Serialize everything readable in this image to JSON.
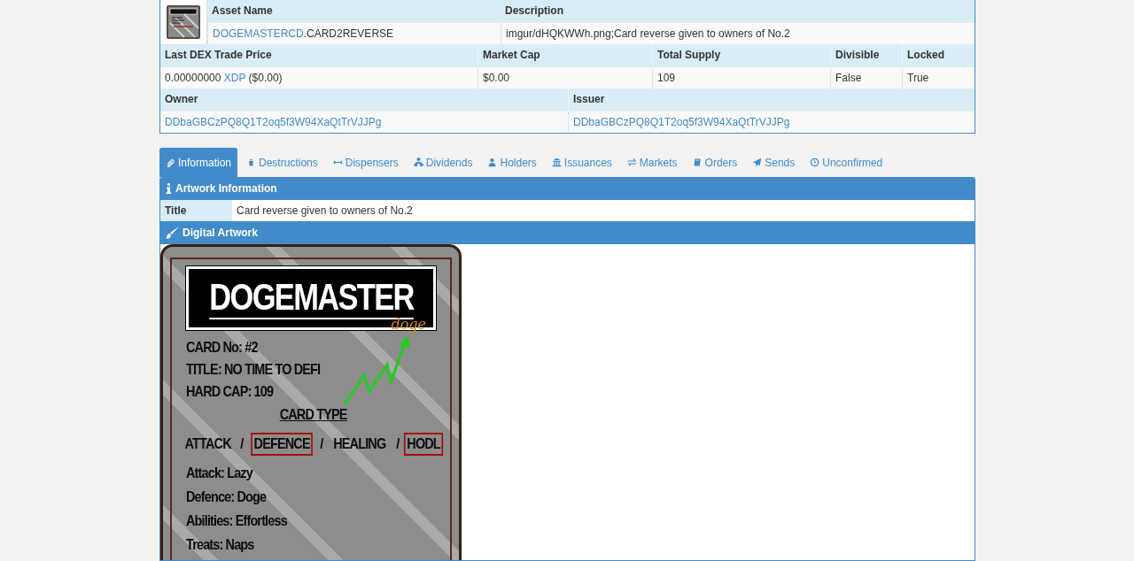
{
  "asset": {
    "name_header": "Asset Name",
    "name_link": "DOGEMASTERCD",
    "name_rest": ".CARD2REVERSE",
    "description_header": "Description",
    "description": "imgur/dHQKWWh.png;Card reverse given to owners of No.2"
  },
  "market": [
    {
      "header": "Last DEX Trade Price",
      "value": [
        {
          "kind": "plain",
          "text": "0.00000000 "
        },
        {
          "kind": "link",
          "text": "XDP"
        },
        {
          "kind": "plain",
          "text": " ($0.00)"
        }
      ]
    },
    {
      "header": "Market Cap",
      "value": [
        {
          "kind": "plain",
          "text": "$0.00"
        }
      ]
    },
    {
      "header": "Total Supply",
      "value": [
        {
          "kind": "plain",
          "text": "109"
        }
      ]
    },
    {
      "header": "Divisible",
      "value": [
        {
          "kind": "plain",
          "text": "False"
        }
      ]
    },
    {
      "header": "Locked",
      "value": [
        {
          "kind": "plain",
          "text": "True"
        }
      ]
    }
  ],
  "parties": [
    {
      "header": "Owner",
      "address": "DDbaGBCzPQ8Q1T2oq5f3W94XaQtTrVJJPg"
    },
    {
      "header": "Issuer",
      "address": "DDbaGBCzPQ8Q1T2oq5f3W94XaQtTrVJJPg"
    }
  ],
  "tabs": [
    {
      "label": "Information",
      "selected": true
    },
    {
      "label": "Destructions",
      "selected": false
    },
    {
      "label": "Dispensers",
      "selected": false
    },
    {
      "label": "Dividends",
      "selected": false
    },
    {
      "label": "Holders",
      "selected": false
    },
    {
      "label": "Issuances",
      "selected": false
    },
    {
      "label": "Markets",
      "selected": false
    },
    {
      "label": "Orders",
      "selected": false
    },
    {
      "label": "Sends",
      "selected": false
    },
    {
      "label": "Unconfirmed",
      "selected": false
    }
  ],
  "artwork_information": {
    "heading": "Artwork Information",
    "title_label": "Title",
    "title": "Card reverse given to owners of No.2"
  },
  "digital_artwork": {
    "heading": "Digital Artwork",
    "card": {
      "logo": "DOGEMASTER",
      "signature": "doge",
      "details": [
        "CARD No: #2",
        "TITLE: NO TIME TO DEFI",
        "HARD CAP: 109"
      ],
      "type_heading": "CARD TYPE",
      "types": [
        {
          "kind": "type",
          "text": "ATTACK",
          "selected": false
        },
        {
          "kind": "separator",
          "text": "/"
        },
        {
          "kind": "type",
          "text": "DEFENCE",
          "selected": true
        },
        {
          "kind": "separator",
          "text": "/"
        },
        {
          "kind": "type",
          "text": "HEALING",
          "selected": false
        },
        {
          "kind": "separator",
          "text": "/"
        },
        {
          "kind": "type",
          "text": "HODL",
          "selected": true
        }
      ],
      "stats": [
        "Attack: Lazy",
        "Defence: Doge",
        "Abilities: Effortless",
        "Treats: Naps"
      ]
    }
  }
}
